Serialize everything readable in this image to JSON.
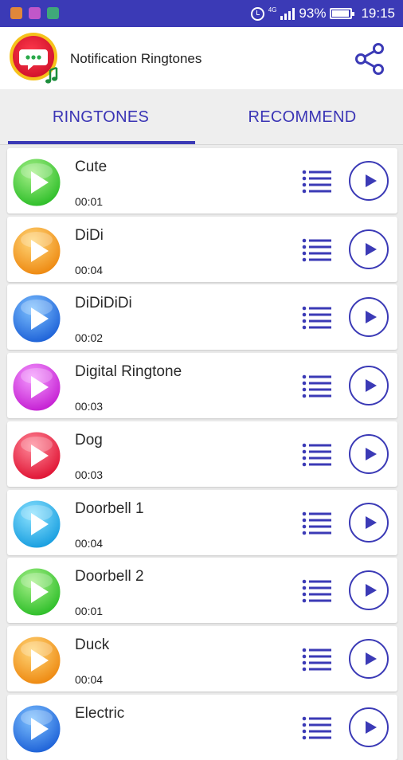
{
  "status_bar": {
    "net_label": "4G",
    "battery": "93%",
    "time": "19:15",
    "app_icon_colors": [
      "#e0873a",
      "#c057c9",
      "#3fa87a"
    ]
  },
  "app_bar": {
    "title": "Notification Ringtones",
    "logo_icon": "chat-bubble-music-icon",
    "share_icon": "share-icon",
    "accent": "#3b3ab6"
  },
  "tabs": [
    {
      "label": "RINGTONES",
      "active": true
    },
    {
      "label": "RECOMMEND",
      "active": false
    }
  ],
  "ringtones": [
    {
      "name": "Cute",
      "duration": "00:01",
      "color": "#2fbf2a",
      "light": "#a8f08a"
    },
    {
      "name": "DiDi",
      "duration": "00:04",
      "color": "#ee8a12",
      "light": "#ffd77a"
    },
    {
      "name": "DiDiDiDi",
      "duration": "00:02",
      "color": "#1f63d8",
      "light": "#7fc2ff"
    },
    {
      "name": "Digital Ringtone",
      "duration": "00:03",
      "color": "#c521d3",
      "light": "#f59bff"
    },
    {
      "name": "Dog",
      "duration": "00:03",
      "color": "#e01535",
      "light": "#ff8a9a"
    },
    {
      "name": "Doorbell 1",
      "duration": "00:04",
      "color": "#1a9fe0",
      "light": "#8ee3ff"
    },
    {
      "name": "Doorbell 2",
      "duration": "00:01",
      "color": "#2fbf2a",
      "light": "#a8f08a"
    },
    {
      "name": "Duck",
      "duration": "00:04",
      "color": "#ee8a12",
      "light": "#ffd77a"
    },
    {
      "name": "Electric",
      "duration": "",
      "color": "#1f63d8",
      "light": "#7fc2ff"
    }
  ]
}
